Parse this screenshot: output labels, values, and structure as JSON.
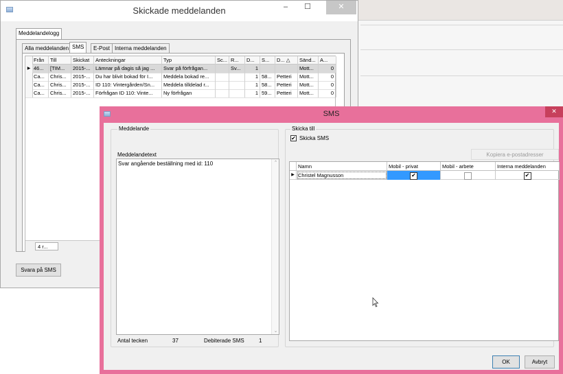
{
  "main": {
    "title": "Skickade meddelanden",
    "window_controls": {
      "minimize": "–",
      "maximize": "☐",
      "close": "✕"
    },
    "outer_tab": "Meddelandelogg",
    "tabs": [
      "Alla meddelanden",
      "SMS",
      "E-Post",
      "Interna meddelanden"
    ],
    "active_tab": "SMS",
    "grid": {
      "columns": [
        "Från",
        "Till",
        "Skickat",
        "Anteckningar",
        "Typ",
        "Sc...",
        "R...",
        "D...",
        "S...",
        "D... △",
        "Sänd...",
        "A..."
      ],
      "rows": [
        [
          "46...",
          "[TIM...",
          "2015-...",
          "Lämnar på dagis så jag ...",
          "Svar på förfrågan...",
          "",
          "Sv...",
          "1",
          "",
          "",
          "Mott...",
          "0"
        ],
        [
          "Ca...",
          "Chris...",
          "2015-...",
          "Du har blivit bokad för I...",
          "Meddela bokad re...",
          "",
          "",
          "1",
          "58...",
          "Petteri",
          "Mott...",
          "0"
        ],
        [
          "Ca...",
          "Chris...",
          "2015-...",
          "ID 110: Vintergården/Sn...",
          "Meddela tilldelad r...",
          "",
          "",
          "1",
          "58...",
          "Petteri",
          "Mott...",
          "0"
        ],
        [
          "Ca...",
          "Chris...",
          "2015-...",
          "Förfrågan ID 110: Vinte...",
          "Ny förfrågan",
          "",
          "",
          "1",
          "59...",
          "Petteri",
          "Mott...",
          "0"
        ]
      ],
      "selected_row": 0,
      "footer": "4 r..."
    },
    "reply_button": "Svara på SMS"
  },
  "sms": {
    "title": "SMS",
    "close": "✕",
    "message_group": "Meddelande",
    "message_text_label": "Meddelandetext",
    "message_text": "Svar angående beställning med id: 110",
    "char_count_label": "Antal tecken",
    "char_count": "37",
    "billed_label": "Debiterade SMS",
    "billed": "1",
    "send_to_group": "Skicka till",
    "send_sms_label": "Skicka SMS",
    "send_sms_checked": true,
    "copy_email_button": "Kopiera e-postadresser",
    "recipients": {
      "columns": [
        "Namn",
        "Mobil - privat",
        "Mobil - arbete",
        "Interna meddelanden"
      ],
      "rows": [
        {
          "name": "Christel Magnusson",
          "mobile_private": true,
          "mobile_work": false,
          "internal": true
        }
      ]
    },
    "ok_button": "OK",
    "cancel_button": "Avbryt"
  },
  "colors": {
    "accent": "#e8709b",
    "selection": "#3399ff"
  }
}
